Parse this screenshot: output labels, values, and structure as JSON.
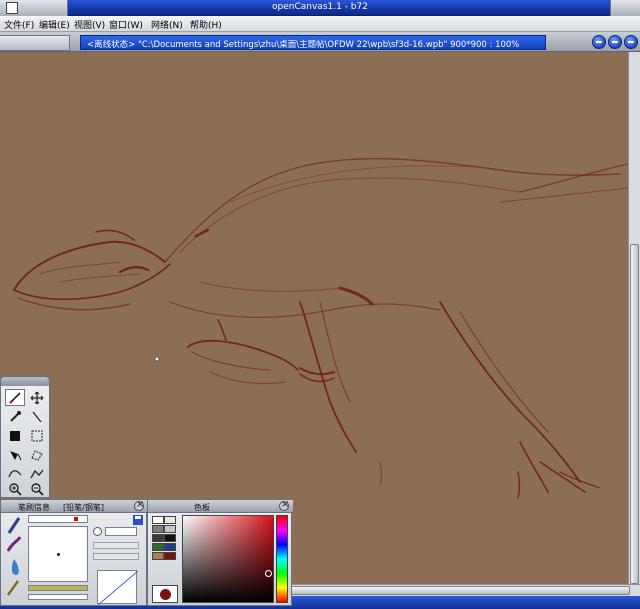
{
  "app": {
    "title": "openCanvas1.1 - b72"
  },
  "menu": [
    "文件(F)",
    "编辑(E)",
    "视图(V)",
    "窗口(W)",
    "网络(N)",
    "帮助(H)"
  ],
  "document": {
    "title": "<离线状态> \"C:\\Documents and Settings\\zhu\\桌面\\主题帖\\OFDW 22\\wpb\\sf3d-16.wpb\" 900*900 : 100%"
  },
  "tools": [
    {
      "name": "pen-tool-icon",
      "selected": true
    },
    {
      "name": "move-tool-icon"
    },
    {
      "name": "eyedropper-tool-icon"
    },
    {
      "name": "line-tool-icon"
    },
    {
      "name": "fill-rect-tool-icon"
    },
    {
      "name": "select-rect-tool-icon"
    },
    {
      "name": "bucket-tool-icon"
    },
    {
      "name": "lasso-tool-icon"
    },
    {
      "name": "curve-tool-icon"
    },
    {
      "name": "polyline-tool-icon"
    },
    {
      "name": "zoom-in-tool-icon"
    },
    {
      "name": "zoom-out-tool-icon"
    }
  ],
  "brush_panel": {
    "tab_label": "笔刷信息",
    "tab2_label": "[铅笔/钢笔]"
  },
  "color_panel": {
    "title": "色板",
    "current_color": "#7a1212",
    "hue_color": "#d8121b",
    "swatches": [
      "#ffffff",
      "#e6e6e6",
      "#7f7f7f",
      "#c6c6c6",
      "#3a3a3a",
      "#111111",
      "#2e6b2e",
      "#1c3f82",
      "#b07a55",
      "#7a1212"
    ]
  },
  "canvas": {
    "background": "#8c6e55",
    "stroke_color": "#6e1a14"
  }
}
